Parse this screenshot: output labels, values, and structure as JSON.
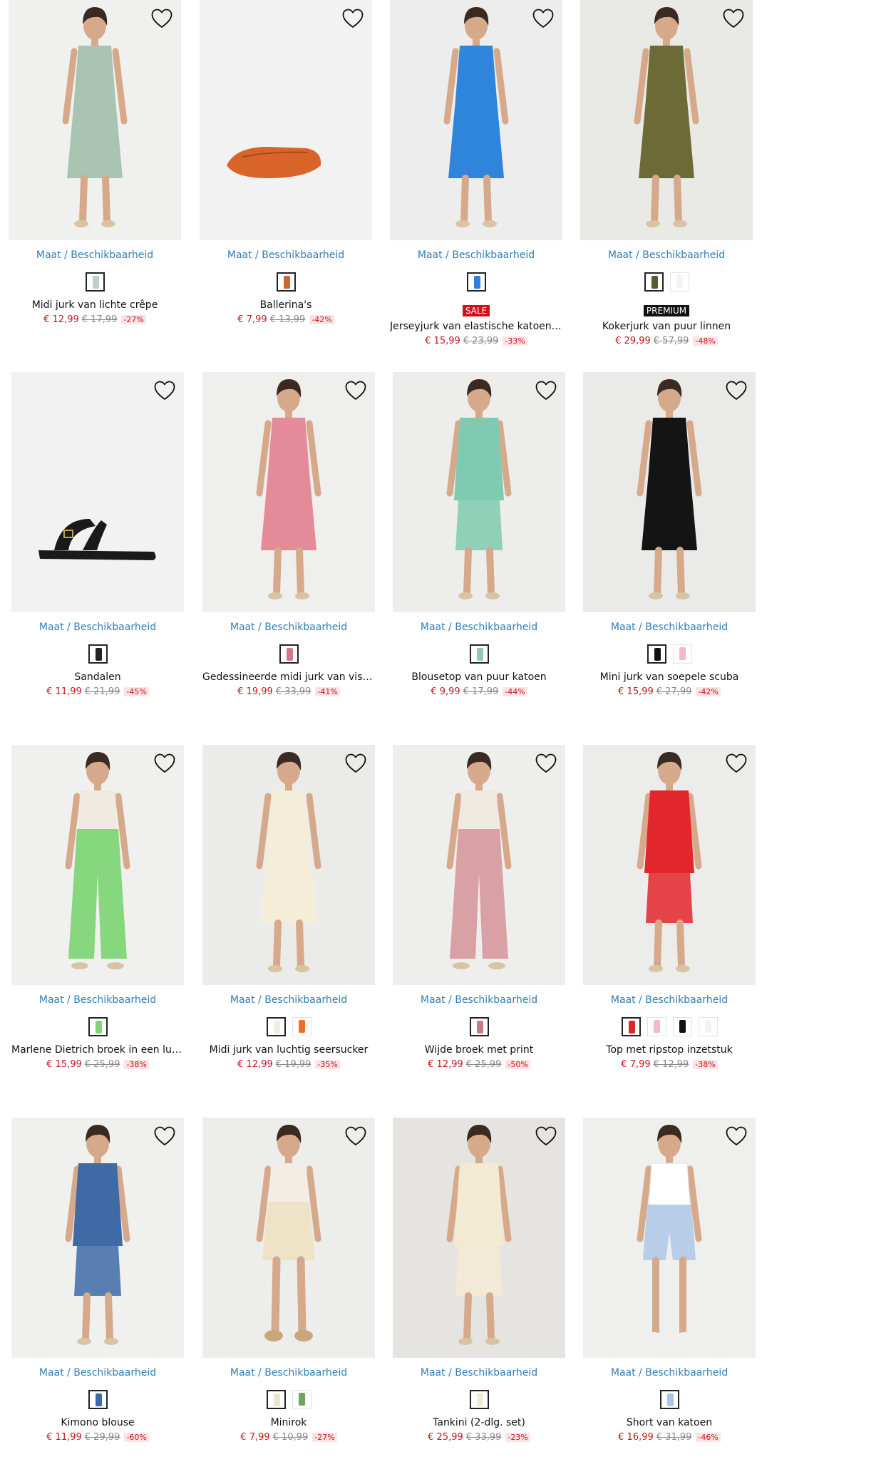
{
  "ui": {
    "availability_label": "Maat / Beschikbaarheid"
  },
  "products": [
    {
      "title": "Midi jurk van lichte crêpe",
      "price": "€ 12,99",
      "old_price": "€ 17,99",
      "discount": "-27%",
      "badge": "",
      "badge_type": "",
      "swatches": [
        "#bcd1c2"
      ],
      "image": {
        "kind": "dress",
        "color": "#a9c4b3",
        "bg": "#f0f0ee"
      }
    },
    {
      "title": "Ballerina's",
      "price": "€ 7,99",
      "old_price": "€ 13,99",
      "discount": "-42%",
      "badge": "",
      "badge_type": "",
      "swatches": [
        "#c8692e"
      ],
      "image": {
        "kind": "shoe",
        "color": "#d9642a",
        "bg": "#f2f2f2"
      }
    },
    {
      "title": "Jerseyjurk van elastische katoenmi...",
      "price": "€ 15,99",
      "old_price": "€ 23,99",
      "discount": "-33%",
      "badge": "SALE",
      "badge_type": "sale",
      "swatches": [
        "#2d7fd8"
      ],
      "image": {
        "kind": "dress",
        "color": "#2f84dc",
        "bg": "#ededed"
      }
    },
    {
      "title": "Kokerjurk van puur linnen",
      "price": "€ 29,99",
      "old_price": "€ 57,99",
      "discount": "-48%",
      "badge": "PREMIUM",
      "badge_type": "prem",
      "swatches": [
        "#5c5a2e",
        "#f4f4f4"
      ],
      "image": {
        "kind": "dress",
        "color": "#6c6b36",
        "bg": "#e9e9e6"
      }
    },
    {
      "title": "Sandalen",
      "price": "€ 11,99",
      "old_price": "€ 21,99",
      "discount": "-45%",
      "badge": "",
      "badge_type": "",
      "swatches": [
        "#222222"
      ],
      "image": {
        "kind": "sandal",
        "color": "#1a1a1a",
        "bg": "#f2f2f2"
      }
    },
    {
      "title": "Gedessineerde midi jurk van viscos...",
      "price": "€ 19,99",
      "old_price": "€ 33,99",
      "discount": "-41%",
      "badge": "",
      "badge_type": "",
      "swatches": [
        "#d8778a"
      ],
      "image": {
        "kind": "dress",
        "color": "#e58a98",
        "bg": "#efefed"
      }
    },
    {
      "title": "Blousetop van puur katoen",
      "price": "€ 9,99",
      "old_price": "€ 17,99",
      "discount": "-44%",
      "badge": "",
      "badge_type": "",
      "swatches": [
        "#8fc9b3"
      ],
      "image": {
        "kind": "top",
        "color": "#7fcab0",
        "bg": "#ededeb"
      }
    },
    {
      "title": "Mini jurk van soepele scuba",
      "price": "€ 15,99",
      "old_price": "€ 27,99",
      "discount": "-42%",
      "badge": "",
      "badge_type": "",
      "swatches": [
        "#111111",
        "#f4b8cc"
      ],
      "image": {
        "kind": "dress",
        "color": "#141414",
        "bg": "#eaeae8"
      }
    },
    {
      "title": "Marlene Dietrich broek in een luch...",
      "price": "€ 15,99",
      "old_price": "€ 25,99",
      "discount": "-38%",
      "badge": "",
      "badge_type": "",
      "swatches": [
        "#7fd579"
      ],
      "image": {
        "kind": "pants",
        "color": "#86d77d",
        "bg": "#f0f0ee"
      }
    },
    {
      "title": "Midi jurk van luchtig seersucker",
      "price": "€ 12,99",
      "old_price": "€ 19,99",
      "discount": "-35%",
      "badge": "",
      "badge_type": "",
      "swatches": [
        "#f3eed9",
        "#f06a2a"
      ],
      "image": {
        "kind": "dress",
        "color": "#f4eed8",
        "bg": "#ebebe9"
      }
    },
    {
      "title": "Wijde broek met print",
      "price": "€ 12,99",
      "old_price": "€ 25,99",
      "discount": "-50%",
      "badge": "",
      "badge_type": "",
      "swatches": [
        "#c97c86"
      ],
      "image": {
        "kind": "pants",
        "color": "#d9a0a6",
        "bg": "#eeeeec"
      }
    },
    {
      "title": "Top met ripstop inzetstuk",
      "price": "€ 7,99",
      "old_price": "€ 12,99",
      "discount": "-38%",
      "badge": "",
      "badge_type": "",
      "swatches": [
        "#e0242b",
        "#f7b9ca",
        "#111111",
        "#f2f2f2"
      ],
      "image": {
        "kind": "top",
        "color": "#e3262c",
        "bg": "#ececea"
      }
    },
    {
      "title": "Kimono blouse",
      "price": "€ 11,99",
      "old_price": "€ 29,99",
      "discount": "-60%",
      "badge": "",
      "badge_type": "",
      "swatches": [
        "#3c6aa8"
      ],
      "image": {
        "kind": "top",
        "color": "#3e6aa6",
        "bg": "#f0f0ee"
      }
    },
    {
      "title": "Minirok",
      "price": "€ 7,99",
      "old_price": "€ 10,99",
      "discount": "-27%",
      "badge": "",
      "badge_type": "",
      "swatches": [
        "#efe6cf",
        "#6fa35f"
      ],
      "image": {
        "kind": "skirt",
        "color": "#eee3c7",
        "bg": "#ededeb"
      }
    },
    {
      "title": "Tankini (2-dlg. set)",
      "price": "€ 25,99",
      "old_price": "€ 33,99",
      "discount": "-23%",
      "badge": "",
      "badge_type": "",
      "swatches": [
        "#f3ead2"
      ],
      "image": {
        "kind": "top",
        "color": "#f3ead3",
        "bg": "#e6e4e0"
      }
    },
    {
      "title": "Short van katoen",
      "price": "€ 16,99",
      "old_price": "€ 31,99",
      "discount": "-46%",
      "badge": "",
      "badge_type": "",
      "swatches": [
        "#a9c4e6"
      ],
      "image": {
        "kind": "shorts",
        "color": "#b7cde8",
        "bg": "#efefed"
      }
    }
  ]
}
